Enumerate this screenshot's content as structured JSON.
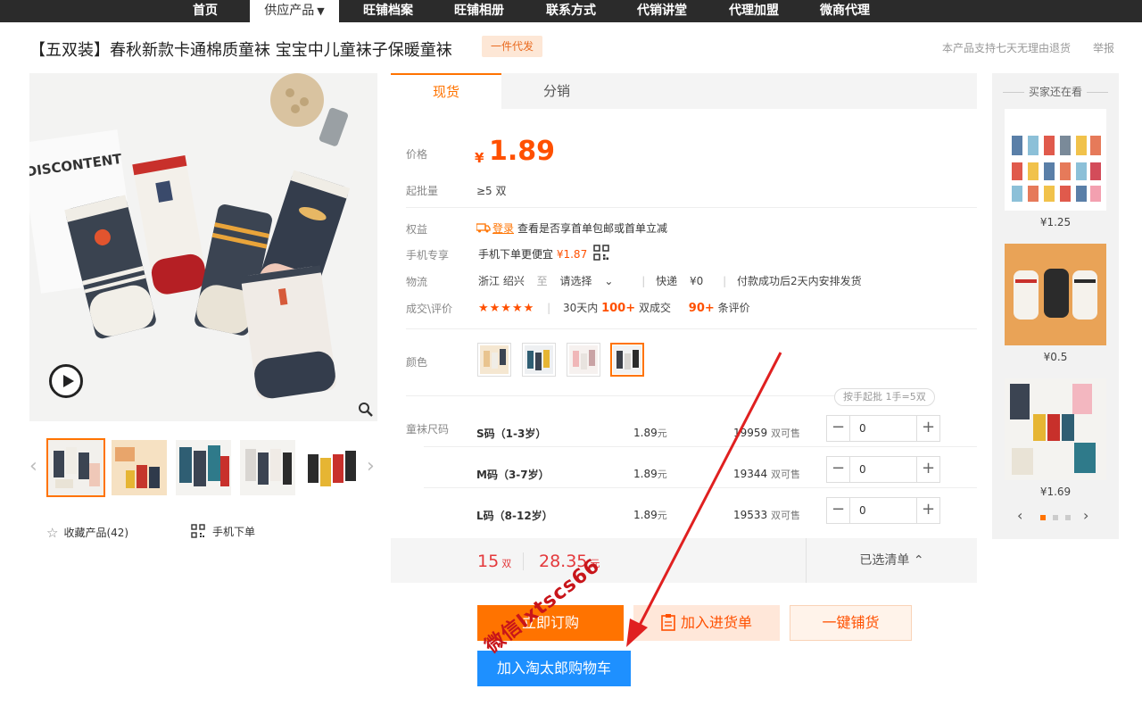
{
  "nav": {
    "items": [
      {
        "label": "首页"
      },
      {
        "label": "供应产品",
        "active": true,
        "has_caret": true
      },
      {
        "label": "旺铺档案"
      },
      {
        "label": "旺铺相册"
      },
      {
        "label": "联系方式"
      },
      {
        "label": "代销讲堂"
      },
      {
        "label": "代理加盟"
      },
      {
        "label": "微商代理"
      }
    ],
    "caret": "▼"
  },
  "product": {
    "title": "【五双装】春秋新款卡通棉质童袜 宝宝中儿童袜子保暖童袜",
    "tag": "一件代发",
    "return_note": "本产品支持七天无理由退货",
    "report": "举报"
  },
  "gallery": {
    "main_image_text": "DISCONTENT",
    "thumbs_count": 5,
    "favorite_label": "收藏产品(42)",
    "mobile_order_label": "手机下单"
  },
  "tabs": [
    {
      "label": "现货",
      "active": true
    },
    {
      "label": "分销",
      "active": false
    }
  ],
  "labels": {
    "price": "价格",
    "min_qty": "起批量",
    "rights": "权益",
    "mobile_excl": "手机专享",
    "logistics": "物流",
    "deals": "成交\\评价",
    "color": "颜色",
    "size": "童袜尺码"
  },
  "price": {
    "symbol": "¥",
    "value": "1.89",
    "min_qty": "≥5  双"
  },
  "rights": {
    "login": "登录",
    "text": "查看是否享首单包邮或首单立减"
  },
  "mobile_excl": {
    "text": "手机下单更便宜",
    "price": "¥1.87"
  },
  "logistics": {
    "from": "浙江 绍兴",
    "to": "至",
    "select": "请选择",
    "express": "快递",
    "fee": "¥0",
    "ship_note": "付款成功后2天内安排发货"
  },
  "deals": {
    "stars": "★★★★★",
    "period": "30天内",
    "count": "100+",
    "count_unit": "双成交",
    "reviews": "90+",
    "reviews_unit": "条评价"
  },
  "colors": {
    "swatches": [
      {
        "color": "#e9c48f"
      },
      {
        "color": "#4d6c86"
      },
      {
        "color": "#f0b7b8"
      },
      {
        "color": "#3c4048",
        "selected": true
      }
    ]
  },
  "sizes": {
    "hint": "按手起批 1手=5双",
    "rows": [
      {
        "name": "S码（1-3岁）",
        "price": "1.89",
        "price_unit": "元",
        "stock": "19959",
        "stock_unit": "双可售",
        "qty": "0"
      },
      {
        "name": "M码（3-7岁）",
        "price": "1.89",
        "price_unit": "元",
        "stock": "19344",
        "stock_unit": "双可售",
        "qty": "0"
      },
      {
        "name": "L码（8-12岁）",
        "price": "1.89",
        "price_unit": "元",
        "stock": "19533",
        "stock_unit": "双可售",
        "qty": "0"
      }
    ]
  },
  "summary": {
    "count": "15",
    "count_unit": "双",
    "total": "28.35",
    "total_unit": "元",
    "picked_list": "已选清单",
    "picked_caret": "⌃"
  },
  "actions": {
    "buy_now": "立即订购",
    "add_list": "加入进货单",
    "one_key": "一键铺货",
    "add_cart": "加入淘太郎购物车"
  },
  "watermark": "微信lxtscs66",
  "recommendations": {
    "title": "买家还在看",
    "items": [
      {
        "price": "¥1.25"
      },
      {
        "price": "¥0.5"
      },
      {
        "price": "¥1.69"
      }
    ],
    "pager": {
      "prev": "‹",
      "next": "›",
      "pages": 3,
      "current": 0
    }
  },
  "colors_theme": {
    "accent": "#ff7300",
    "price": "#ff5000",
    "summary_red": "#e4393c",
    "cart_blue": "#1e90ff",
    "nav_bg": "#2b2b2b"
  }
}
